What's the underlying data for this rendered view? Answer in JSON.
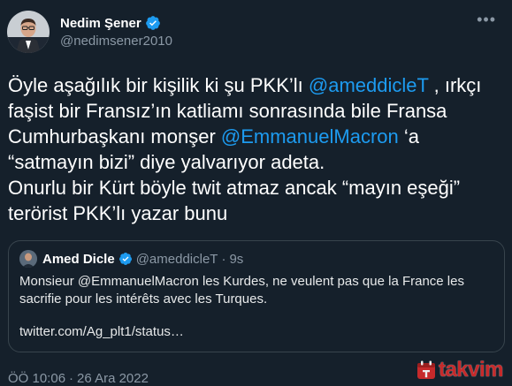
{
  "author": {
    "name": "Nedim Şener",
    "handle": "@nedimsener2010",
    "verified": true
  },
  "tweet": {
    "segments": [
      {
        "text": "Öyle aşağılık bir kişilik ki şu PKK’lı ",
        "type": "text"
      },
      {
        "text": "@ameddicleT",
        "type": "mention"
      },
      {
        "text": " , ırkçı faşist bir Fransız’ın katliamı sonrasında bile Fransa Cumhurbaşkanı monşer ",
        "type": "text"
      },
      {
        "text": "@EmmanuelMacron",
        "type": "mention"
      },
      {
        "text": " ‘a “satmayın bizi” diye yalvarıyor adeta.",
        "type": "text"
      },
      {
        "text": "Onurlu bir Kürt böyle twit atmaz ancak “mayın eşeği” terörist PKK’lı yazar bunu",
        "type": "text"
      }
    ]
  },
  "quote": {
    "name": "Amed Dicle",
    "handle": "@ameddicleT",
    "dot": "·",
    "time": "9s",
    "text": "Monsieur @EmmanuelMacron les Kurdes, ne veulent pas que la France les sacrifie pour les intérêts avec les Turques.",
    "link": "twitter.com/Ag_plt1/status…"
  },
  "meta": {
    "time": "ÖÖ 10:06",
    "sep": "·",
    "date": "26 Ara 2022"
  },
  "watermark": {
    "text": "takvim"
  },
  "icons": {
    "more": "more-horizontal-icon",
    "verified": "verified-badge-icon"
  },
  "colors": {
    "background": "#15202b",
    "accent": "#1d9bf0",
    "muted": "#8b98a5",
    "border": "#38444d",
    "watermark": "#d62b2b"
  }
}
